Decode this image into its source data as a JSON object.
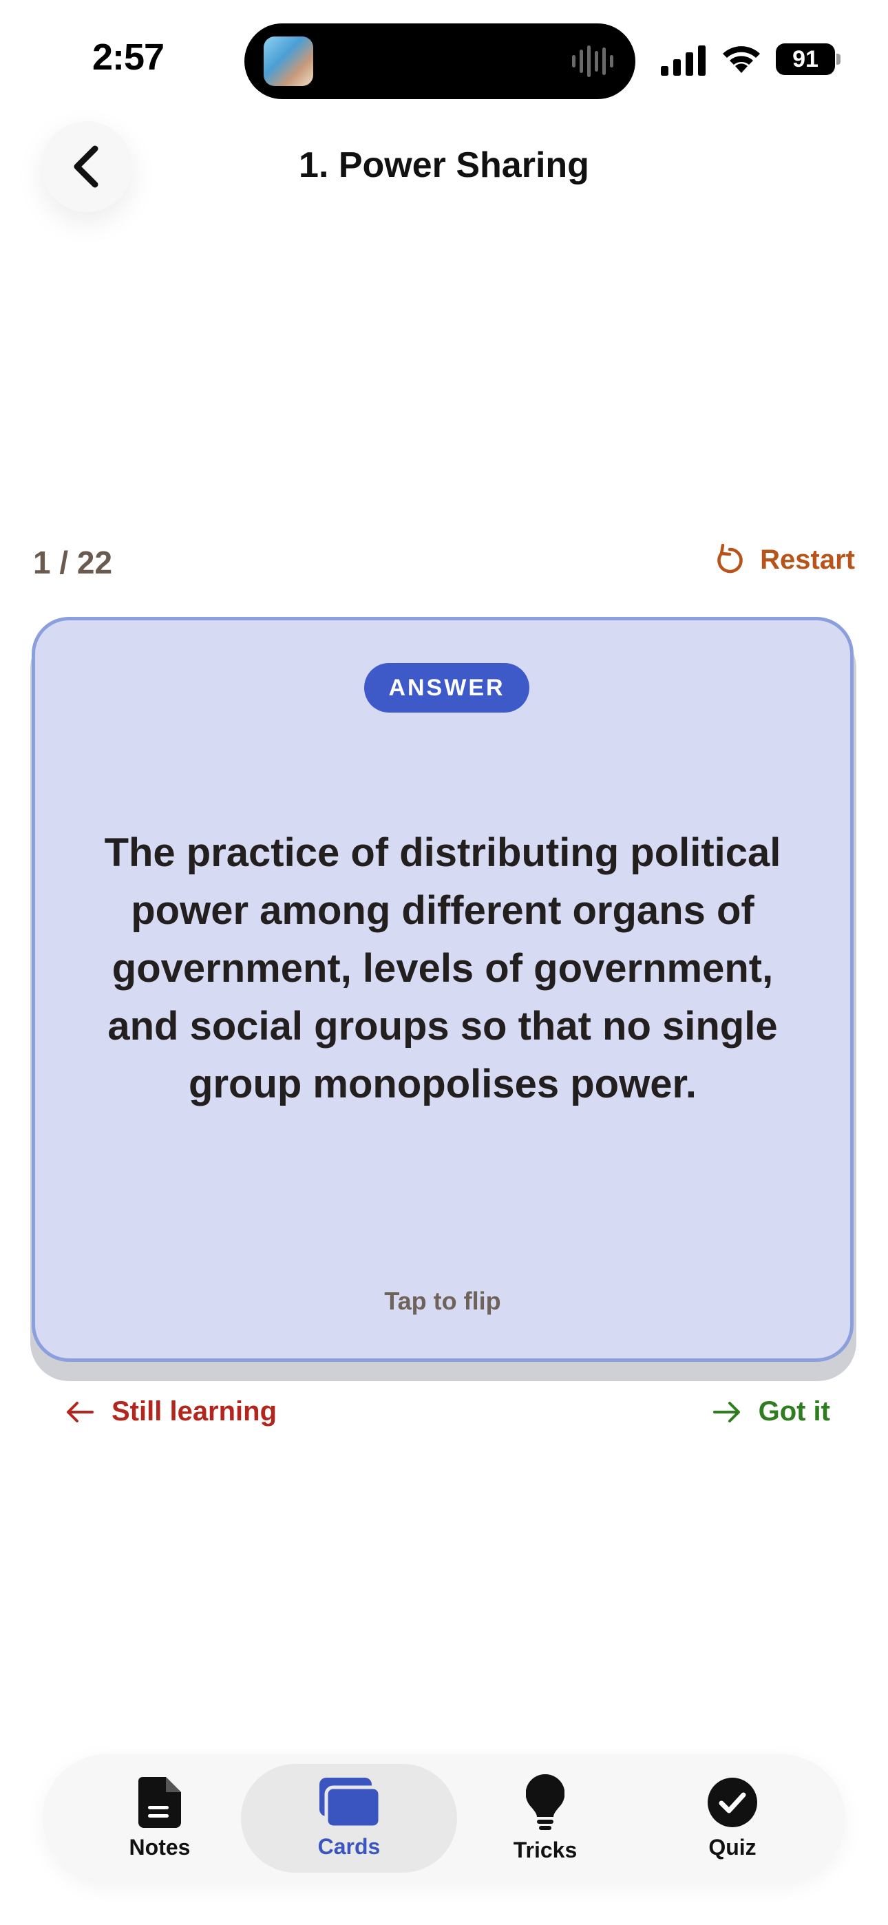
{
  "status_bar": {
    "time": "2:57",
    "battery": "91"
  },
  "header": {
    "title": "1. Power Sharing"
  },
  "progress": {
    "counter": "1 / 22",
    "restart_label": "Restart"
  },
  "card": {
    "badge": "ANSWER",
    "text": "The practice of distributing political power among different organs of government, levels of government, and social groups so that no single group monopolises power.",
    "hint": "Tap to flip",
    "background_color": "#d6daf3",
    "border_color": "#8a9fdc"
  },
  "actions": {
    "still_learning": "Still learning",
    "got_it": "Got it"
  },
  "tabs": [
    {
      "label": "Notes",
      "icon": "document-icon"
    },
    {
      "label": "Cards",
      "icon": "cards-icon",
      "active": true
    },
    {
      "label": "Tricks",
      "icon": "lightbulb-icon"
    },
    {
      "label": "Quiz",
      "icon": "check-circle-icon"
    }
  ],
  "colors": {
    "accent": "#3d5ac8",
    "restart": "#b8531a",
    "still_learning": "#b3261e",
    "got_it": "#2e7d1e"
  }
}
